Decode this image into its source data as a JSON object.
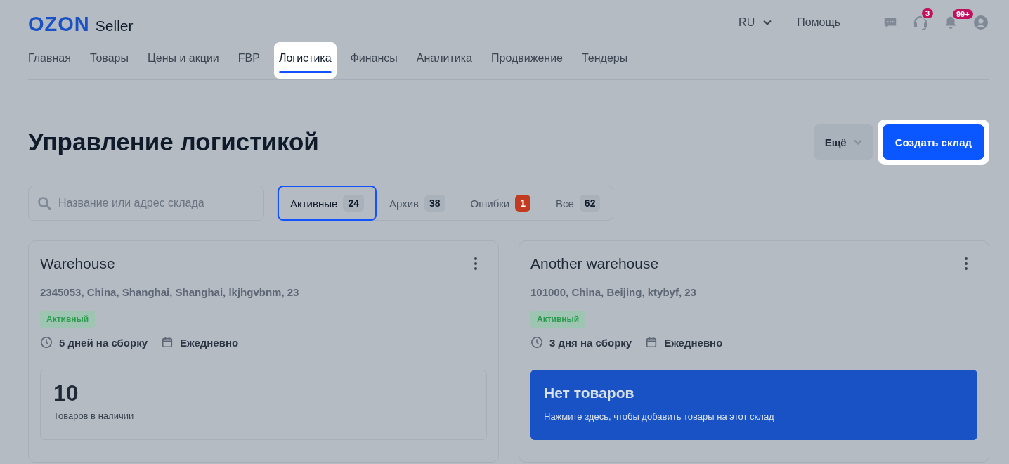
{
  "header": {
    "logo": "OZON",
    "logo_suffix": "Seller",
    "language": "RU",
    "help": "Помощь",
    "icons": [
      {
        "kind": "chat"
      },
      {
        "kind": "support",
        "badge": "3"
      },
      {
        "kind": "bell",
        "badge": "99+"
      },
      {
        "kind": "profile"
      }
    ]
  },
  "nav": [
    {
      "label": "Главная",
      "selected": false,
      "spotlight": false
    },
    {
      "label": "Товары",
      "selected": false,
      "spotlight": false
    },
    {
      "label": "Цены и акции",
      "selected": false,
      "spotlight": false
    },
    {
      "label": "FBP",
      "selected": false,
      "spotlight": false
    },
    {
      "label": "Логистика",
      "selected": true,
      "spotlight": true
    },
    {
      "label": "Финансы",
      "selected": false,
      "spotlight": false
    },
    {
      "label": "Аналитика",
      "selected": false,
      "spotlight": false
    },
    {
      "label": "Продвижение",
      "selected": false,
      "spotlight": false
    },
    {
      "label": "Тендеры",
      "selected": false,
      "spotlight": false
    }
  ],
  "page_title": "Управление логистикой",
  "more_button": "Ещё",
  "create_button": {
    "label": "Создать склад",
    "spotlight": true
  },
  "search": {
    "placeholder": "Название или адрес склада"
  },
  "filters": [
    {
      "label": "Активные",
      "count": "24",
      "selected": true,
      "alert": false
    },
    {
      "label": "Архив",
      "count": "38",
      "selected": false,
      "alert": false
    },
    {
      "label": "Ошибки",
      "count": "1",
      "selected": false,
      "alert": true
    },
    {
      "label": "Все",
      "count": "62",
      "selected": false,
      "alert": false
    }
  ],
  "warehouses": [
    {
      "name": "Warehouse",
      "address": "2345053, China, Shanghai, Shanghai, lkjhgvbnm, 23",
      "status": "Активный",
      "assembly": "5 дней на сборку",
      "schedule": "Ежедневно",
      "stock": {
        "kind": "count",
        "value": "10",
        "caption": "Товаров в наличии"
      }
    },
    {
      "name": "Another warehouse",
      "address": "101000, China, Beijing, ktybyf, 23",
      "status": "Активный",
      "assembly": "3 дня на сборку",
      "schedule": "Ежедневно",
      "stock": {
        "kind": "empty",
        "value": "Нет товаров",
        "caption": "Нажмите здесь, чтобы добавить товары на этот склад"
      }
    }
  ]
}
